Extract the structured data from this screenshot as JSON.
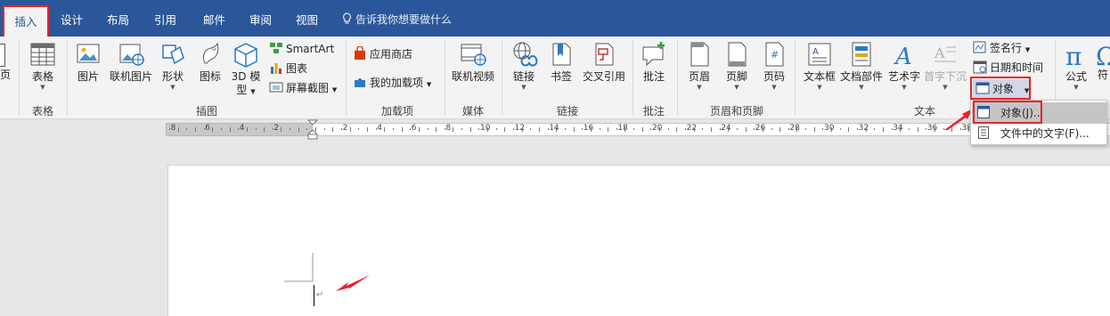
{
  "tabs": [
    {
      "label": "插入",
      "active": true
    },
    {
      "label": "设计"
    },
    {
      "label": "布局"
    },
    {
      "label": "引用"
    },
    {
      "label": "邮件"
    },
    {
      "label": "审阅"
    },
    {
      "label": "视图"
    }
  ],
  "tell_me": "告诉我你想要做什么",
  "ribbon": {
    "partial_left_label": "页",
    "groups": {
      "tables": {
        "label": "表格",
        "table": "表格"
      },
      "illustrations": {
        "label": "插图",
        "picture": "图片",
        "online_picture": "联机图片",
        "shapes": "形状",
        "icons": "图标",
        "model_3d_line1": "3D 模",
        "model_3d_line2": "型",
        "smartart": "SmartArt",
        "chart": "图表",
        "screenshot": "屏幕截图"
      },
      "addins": {
        "label": "加载项",
        "store": "应用商店",
        "my_addins": "我的加载项"
      },
      "media": {
        "label": "媒体",
        "online_video": "联机视频"
      },
      "links": {
        "label": "链接",
        "link": "链接",
        "bookmark": "书签",
        "cross_ref": "交叉引用"
      },
      "comments": {
        "label": "批注",
        "comment": "批注"
      },
      "header_footer": {
        "label": "页眉和页脚",
        "header": "页眉",
        "footer": "页脚",
        "page_number": "页码"
      },
      "text": {
        "label": "文本",
        "text_box": "文本框",
        "quick_parts": "文档部件",
        "wordart": "艺术字",
        "drop_cap": "首字下沉",
        "signature_line": "签名行",
        "date_time": "日期和时间",
        "object": "对象"
      },
      "symbols": {
        "equation": "公式",
        "symbol_partial": "符"
      }
    }
  },
  "ruler": {
    "labels": [
      "8",
      "6",
      "4",
      "2",
      "2",
      "4",
      "6",
      "8",
      "10",
      "12",
      "14",
      "16",
      "18",
      "20",
      "22",
      "24",
      "26",
      "28",
      "30",
      "32",
      "34",
      "36",
      "38"
    ]
  },
  "dropdown": {
    "items": [
      {
        "label": "对象(J)...",
        "highlighted": true
      },
      {
        "label": "文件中的文字(F)..."
      }
    ]
  },
  "document": {
    "paragraph_mark": "↵"
  },
  "colors": {
    "accent": "#2b579a",
    "highlight_box": "#e8242b"
  }
}
